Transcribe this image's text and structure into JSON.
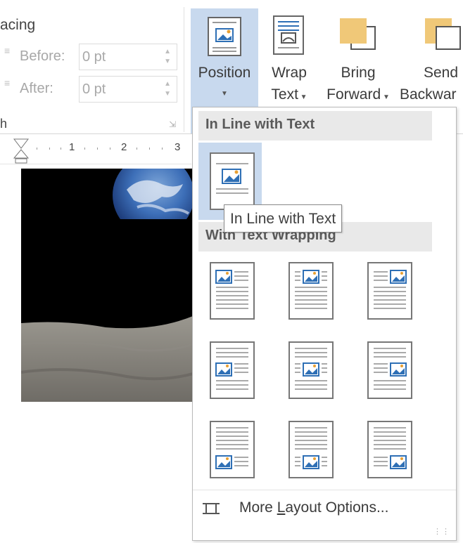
{
  "paragraph_group": {
    "spacing_label": "acing",
    "before_label": "Before:",
    "before_value": "0 pt",
    "after_label": "After:",
    "after_value": "0 pt",
    "group_label": "h"
  },
  "ribbon": {
    "position": {
      "label": "Position",
      "icon": "position-icon"
    },
    "wrap_text": {
      "label_line1": "Wrap",
      "label_line2": "Text",
      "icon": "wrap-text-icon"
    },
    "bring_forward": {
      "label_line1": "Bring",
      "label_line2": "Forward",
      "icon": "bring-forward-icon"
    },
    "send_backward": {
      "label_line1": "Send",
      "label_line2": "Backwar",
      "icon": "send-backward-icon"
    }
  },
  "ruler": {
    "numbers": [
      "1",
      "2",
      "3"
    ]
  },
  "dropdown": {
    "section_inline": "In Line with Text",
    "section_wrapping": "With Text Wrapping",
    "tooltip": "In Line with Text",
    "more_layout_options": "More Layout Options...",
    "more_layout_mnemonic": "L",
    "more_layout_icon": "layout-options-icon"
  },
  "colors": {
    "selected_bg": "#c8d9ee",
    "header_bg": "#e9e9e9",
    "icon_blue": "#2e6fb5",
    "icon_orange": "#e8a033",
    "bring_forward_fill": "#f0c878"
  }
}
